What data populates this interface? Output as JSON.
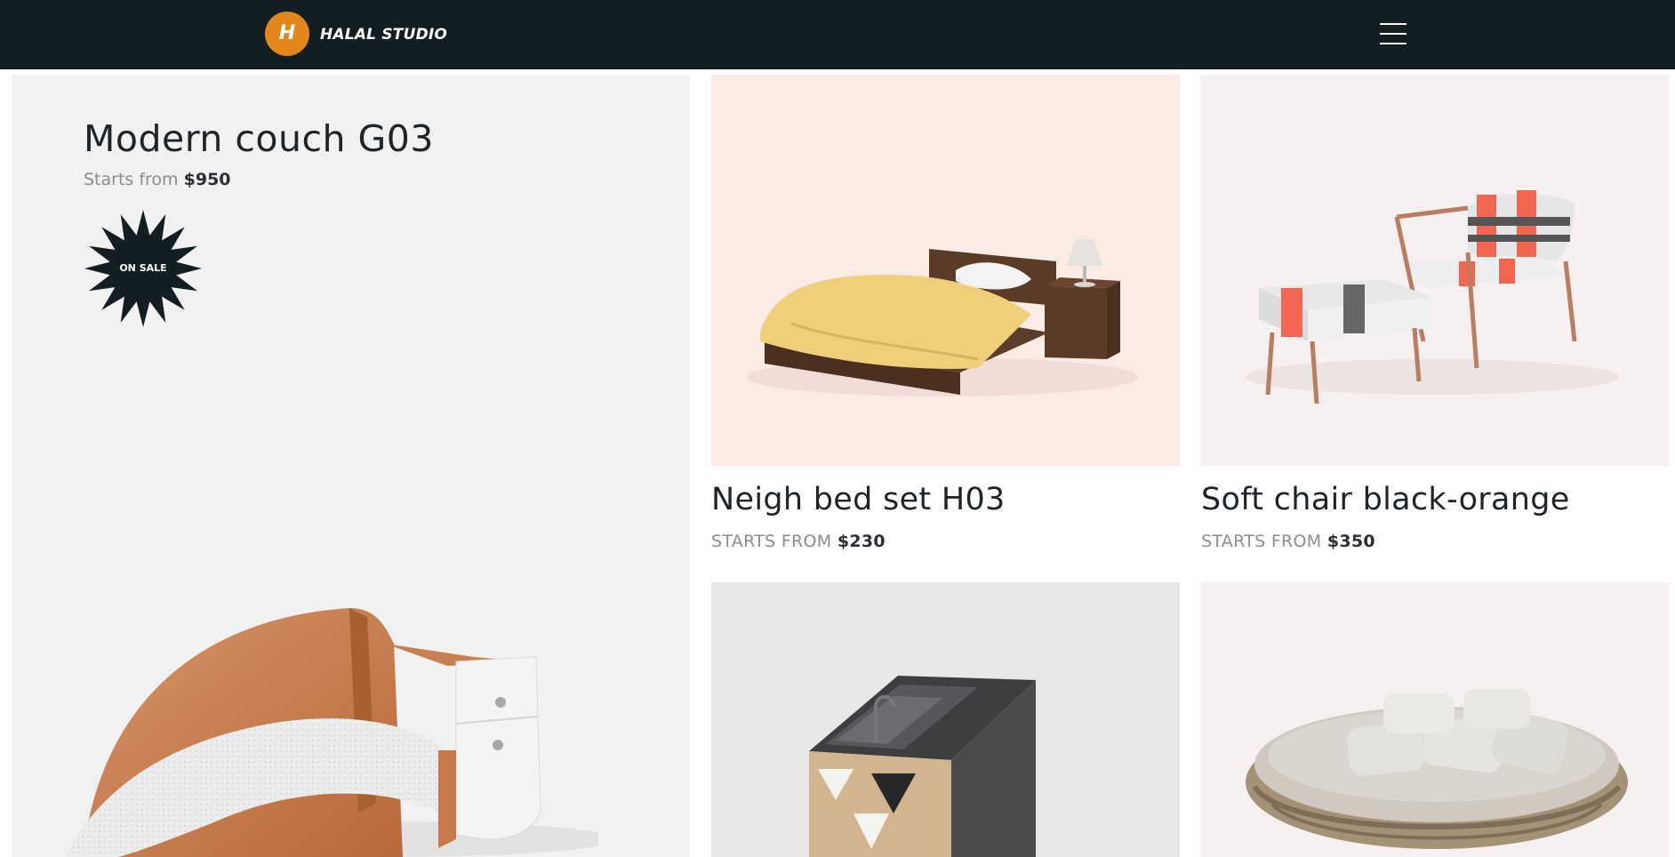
{
  "header": {
    "brand": "HALAL STUDIO",
    "logo_mark": "H",
    "menu_icon": "hamburger-menu-icon",
    "background": "#131e23",
    "logo_color": "#e3861b"
  },
  "featured": {
    "title": "Modern couch G03",
    "price_prefix": "Starts from",
    "price": "$950",
    "badge": "ON SALE",
    "background": "#f1f1f2"
  },
  "products": [
    {
      "title": "Neigh bed set H03",
      "price_prefix": "STARTS FROM",
      "price": "$230",
      "background": "#fbebe5"
    },
    {
      "title": "Soft chair black-orange",
      "price_prefix": "STARTS FROM",
      "price": "$350",
      "background": "#f7f0f0"
    },
    {
      "title": "",
      "price_prefix": "",
      "price": "",
      "background": "#e8e8e9"
    },
    {
      "title": "",
      "price_prefix": "",
      "price": "",
      "background": "#f7f0f0"
    }
  ]
}
